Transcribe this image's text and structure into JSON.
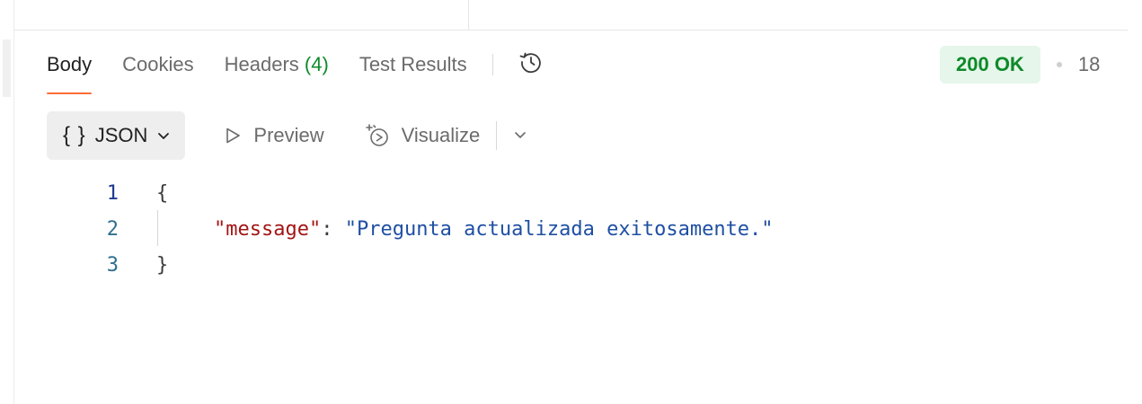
{
  "response_tabs": [
    {
      "label": "Body",
      "active": true
    },
    {
      "label": "Cookies",
      "active": false
    },
    {
      "label": "Headers",
      "count": "(4)",
      "active": false
    },
    {
      "label": "Test Results",
      "active": false
    }
  ],
  "history_icon": "history-icon",
  "status": {
    "code_text": "200 OK",
    "time_partial": "18",
    "badge_color": "#0e8a2a",
    "badge_bg": "#e6f6ea"
  },
  "toolbar": {
    "format_braces": "{ }",
    "format_label": "JSON",
    "preview_label": "Preview",
    "visualize_label": "Visualize"
  },
  "code": {
    "lines": [
      {
        "number": "1",
        "brace": "{"
      },
      {
        "number": "2",
        "key": "\"message\"",
        "colon": ": ",
        "value": "\"Pregunta actualizada exitosamente.\""
      },
      {
        "number": "3",
        "brace": "}"
      }
    ]
  },
  "colors": {
    "accent_tab": "#ff6c37",
    "json_key": "#a31515",
    "json_string": "#1f4fa3"
  }
}
